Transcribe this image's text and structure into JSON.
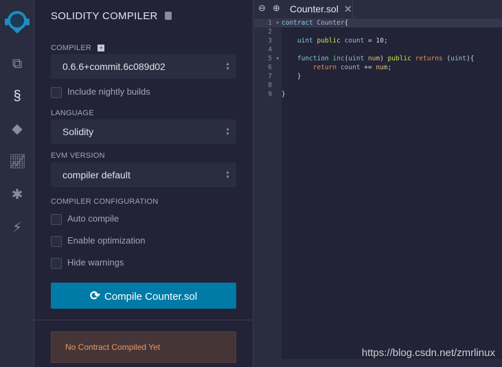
{
  "iconbar": {
    "items": [
      {
        "icon": "remix-logo-icon"
      },
      {
        "icon": "file-explorer-icon"
      },
      {
        "icon": "solidity-compiler-icon"
      },
      {
        "icon": "deploy-run-icon"
      },
      {
        "icon": "analysis-icon"
      },
      {
        "icon": "debugger-icon"
      },
      {
        "icon": "plugin-manager-icon"
      }
    ]
  },
  "panel": {
    "title": "SOLIDITY COMPILER",
    "compiler_label": "COMPILER",
    "compiler_value": "0.6.6+commit.6c089d02",
    "nightly_label": "Include nightly builds",
    "language_label": "LANGUAGE",
    "language_value": "Solidity",
    "evm_label": "EVM VERSION",
    "evm_value": "compiler default",
    "config_label": "COMPILER CONFIGURATION",
    "auto_compile": "Auto compile",
    "optimization": "Enable optimization",
    "hide_warnings": "Hide warnings",
    "compile_button": "Compile Counter.sol",
    "status": "No Contract Compiled Yet",
    "accent": "#007aa6"
  },
  "editor": {
    "tab": "Counter.sol",
    "line_numbers": [
      "1",
      "2",
      "3",
      "4",
      "5",
      "6",
      "7",
      "8",
      "9"
    ],
    "lines": [
      "contract Counter{",
      "",
      "    uint public count = 10;",
      "",
      "    function inc(uint num) public returns (uint){",
      "        return count += num;",
      "    }",
      "",
      "}"
    ]
  },
  "watermark": "https://blog.csdn.net/zmrlinux"
}
